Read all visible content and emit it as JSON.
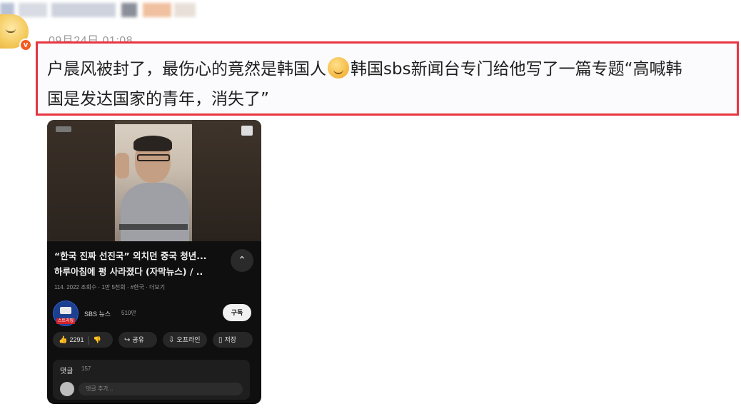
{
  "post": {
    "timestamp": "09月24日 01:08",
    "text_line1_a": "户晨风被封了，最伤心的竟然是韩国人",
    "text_line1_b": "韩国sbs新闻台专门给他写了一篇专题“高喊韩",
    "text_line2": "国是发达国家的青年，消失了”",
    "emoji_icon": "drooling-face-emoji",
    "highlight_color": "#e8343f",
    "verified_color": "#f35b23",
    "verified_symbol": "v"
  },
  "video": {
    "title_line1": "“한국 진짜 선진국” 외치던 중국 청년...",
    "title_line2": "하루아침에 펑 사라졌다 (자막뉴스) / ..",
    "meta": "114. 2022 조회수 · 1만 5천회 · #한국 · 더보기",
    "expand_symbol": "⌃",
    "channel_name": "SBS 뉴스",
    "channel_subs": "510만",
    "channel_badge": "스트리밍",
    "subscribe_label": "구독",
    "like_count": "2291",
    "share_label": "공유",
    "download_label": "오프라인",
    "save_label": "저장",
    "comments_label": "댓글",
    "comments_count": "157",
    "comment_placeholder": "댓글 추가..."
  }
}
